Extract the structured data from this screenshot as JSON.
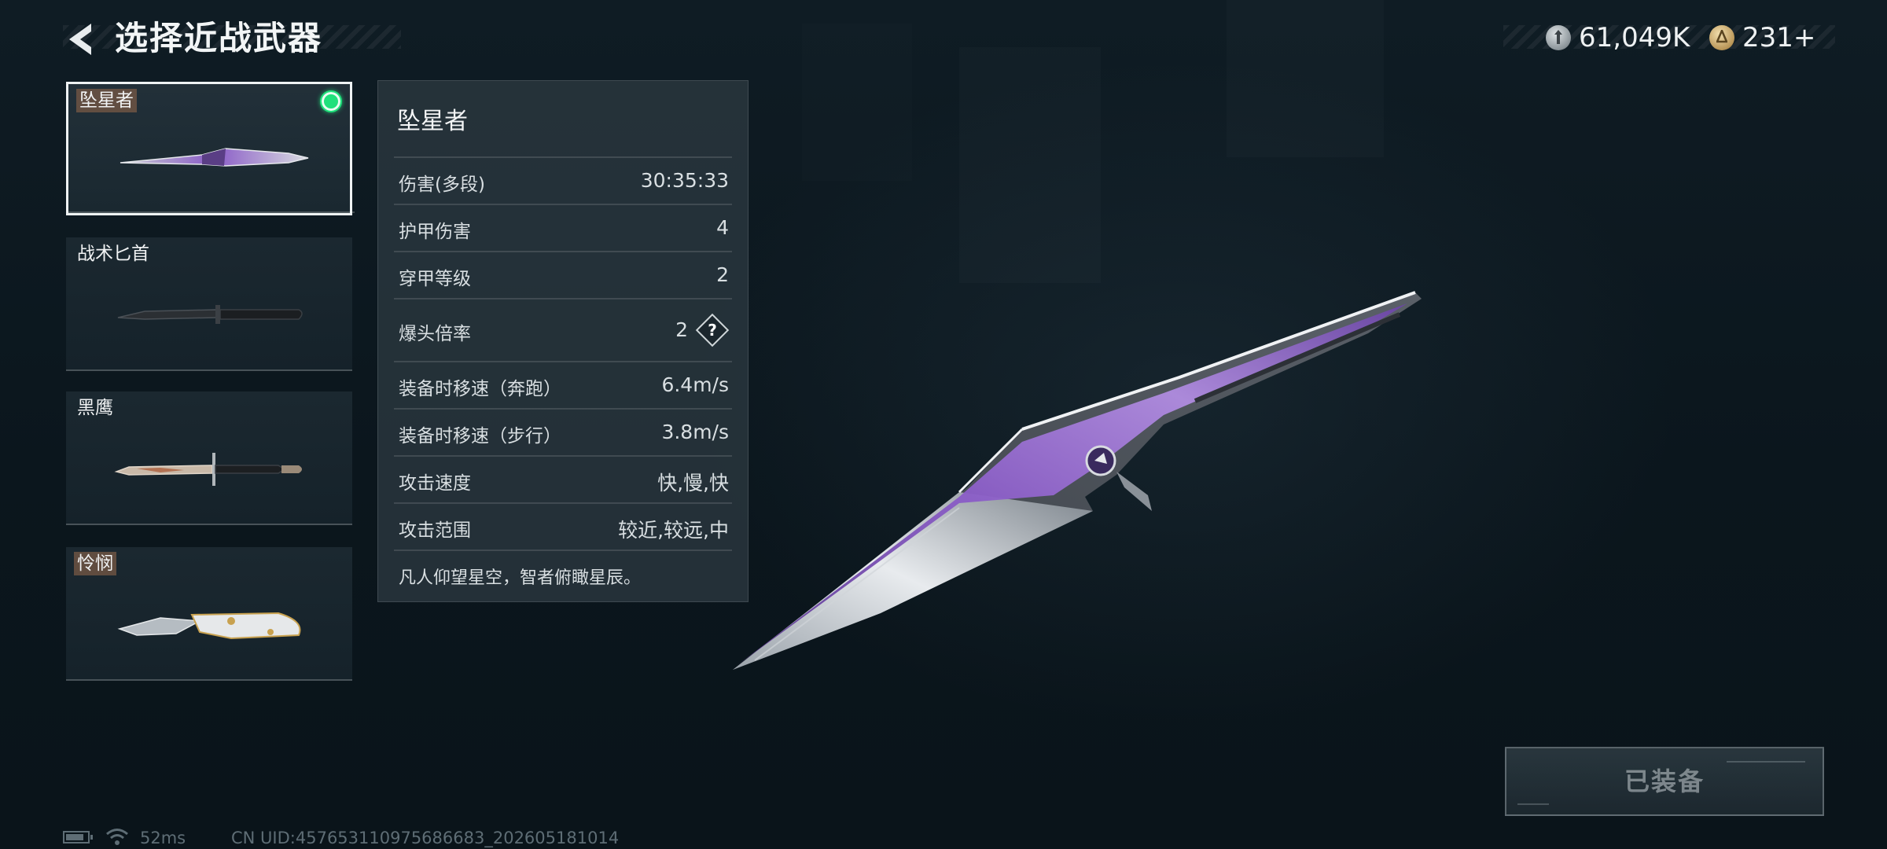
{
  "header": {
    "title": "选择近战武器"
  },
  "currency": [
    {
      "icon": "silver-coin-icon",
      "value": "61,049K"
    },
    {
      "icon": "gold-coin-icon",
      "value": "231+"
    }
  ],
  "weapons": [
    {
      "name": "坠星者",
      "selected": true,
      "equipped": true
    },
    {
      "name": "战术匕首",
      "selected": false,
      "equipped": false
    },
    {
      "name": "黑鹰",
      "selected": false,
      "equipped": false
    },
    {
      "name": "怜悯",
      "selected": false,
      "equipped": false
    }
  ],
  "stats": {
    "title": "坠星者",
    "rows": [
      {
        "label": "伤害(多段)",
        "value": "30:35:33"
      },
      {
        "label": "护甲伤害",
        "value": "4"
      },
      {
        "label": "穿甲等级",
        "value": "2"
      },
      {
        "label": "爆头倍率",
        "value": "2",
        "help": "?"
      },
      {
        "label": "装备时移速（奔跑）",
        "value": "6.4m/s"
      },
      {
        "label": "装备时移速（步行）",
        "value": "3.8m/s"
      },
      {
        "label": "攻击速度",
        "value": "快,慢,快"
      },
      {
        "label": "攻击范围",
        "value": "较近,较远,中"
      }
    ],
    "description": "凡人仰望星空，智者俯瞰星辰。"
  },
  "equip_button": {
    "label": "已装备"
  },
  "footer": {
    "ping": "52ms",
    "uid": "CN UID:457653110975686683_202605181014"
  },
  "colors": {
    "equipped_dot": "#1fe07b",
    "background": "#0d1920",
    "knife_accent": "#8a5cc7"
  }
}
